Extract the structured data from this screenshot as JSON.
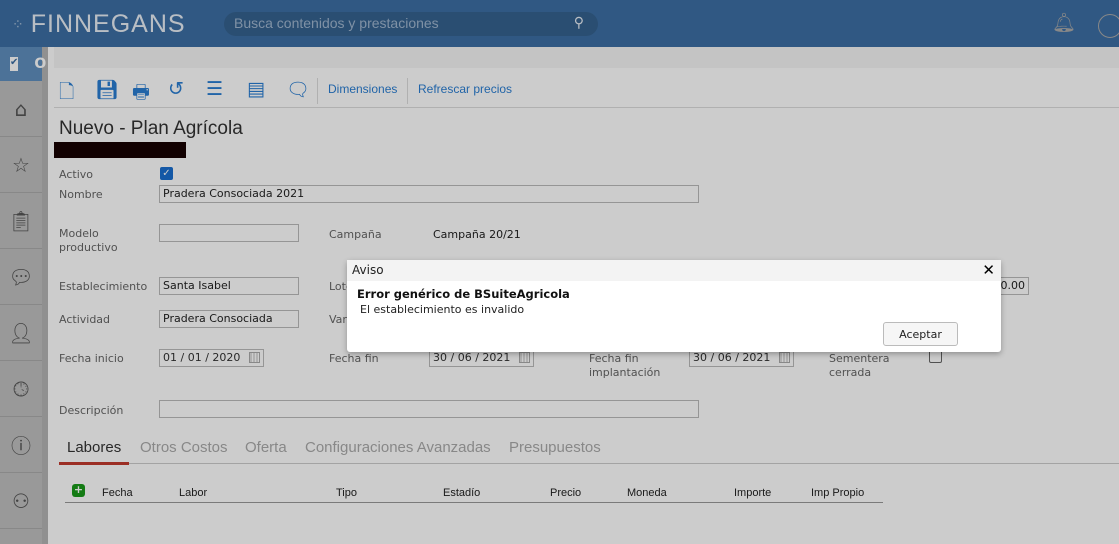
{
  "header": {
    "brand": "FINNEGANS",
    "search_placeholder": "Busca contenidos y prestaciones"
  },
  "sidebar": {
    "top_label": "O",
    "items": [
      "home",
      "favorites",
      "clipboard",
      "chat",
      "add-user",
      "clock",
      "help",
      "support"
    ]
  },
  "toolbar": {
    "dimensiones": "Dimensiones",
    "refrescar": "Refrescar precios"
  },
  "page": {
    "title": "Nuevo - Plan Agrícola"
  },
  "form": {
    "activo_label": "Activo",
    "activo_checked": true,
    "nombre_label": "Nombre",
    "nombre_value": "Pradera Consociada 2021",
    "modelo_label": "Modelo productivo",
    "modelo_value": "",
    "campana_label": "Campaña",
    "campana_value": "Campaña 20/21",
    "establecimiento_label": "Establecimiento",
    "establecimiento_value": "Santa Isabel",
    "lote_label": "Lote",
    "right_value": "0.00",
    "actividad_label": "Actividad",
    "actividad_value": "Pradera Consociada",
    "variedad_label": "Var",
    "fecha_inicio_label": "Fecha inicio",
    "fecha_inicio": "01 / 01 / 2020",
    "fecha_fin_label": "Fecha fin",
    "fecha_fin": "30 / 06 / 2021",
    "fecha_fin_impl_label": "Fecha fin implantación",
    "fecha_fin_impl": "30 / 06 / 2021",
    "sementera_label": "Sementera cerrada",
    "sementera_checked": false,
    "descripcion_label": "Descripción",
    "descripcion_value": ""
  },
  "tabs": [
    "Labores",
    "Otros Costos",
    "Oferta",
    "Configuraciones Avanzadas",
    "Presupuestos"
  ],
  "table": {
    "columns": [
      "Fecha",
      "Labor",
      "Tipo",
      "Estadío",
      "Precio",
      "Moneda",
      "Importe",
      "Imp Propio"
    ]
  },
  "dialog": {
    "title": "Aviso",
    "close": "✕",
    "error": "Error genérico de BSuiteAgricola",
    "message": "El establecimiento es invalido",
    "ok": "Aceptar"
  }
}
